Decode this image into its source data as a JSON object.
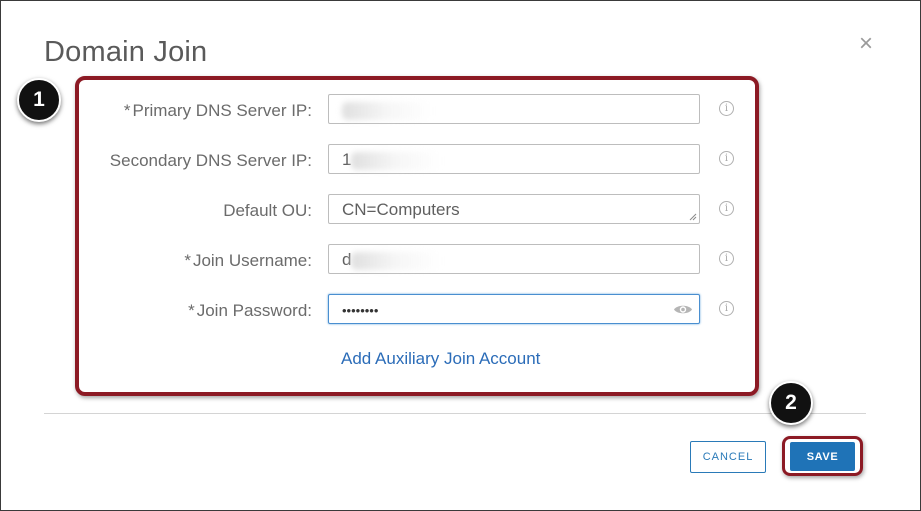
{
  "dialog": {
    "title": "Domain Join",
    "close_glyph": "×"
  },
  "callouts": {
    "badge_1": "1",
    "badge_2": "2",
    "color": "#8c1a24"
  },
  "form": {
    "required_marker": "*",
    "fields": [
      {
        "label": "Primary DNS Server IP:",
        "required": true,
        "value": "",
        "redacted": true
      },
      {
        "label": "Secondary DNS Server IP:",
        "required": false,
        "value": "1",
        "redacted": true
      },
      {
        "label": "Default OU:",
        "required": false,
        "value": "CN=Computers",
        "redacted": false
      },
      {
        "label": "Join Username:",
        "required": true,
        "value": "d",
        "redacted": true
      },
      {
        "label": "Join Password:",
        "required": true,
        "value": "••••••••",
        "redacted": false
      }
    ],
    "info_icon_glyph": "i",
    "add_link": "Add Auxiliary Join Account"
  },
  "footer": {
    "cancel_label": "CANCEL",
    "save_label": "SAVE"
  },
  "colors": {
    "accent": "#1f73b7",
    "link": "#2b6cb8"
  }
}
